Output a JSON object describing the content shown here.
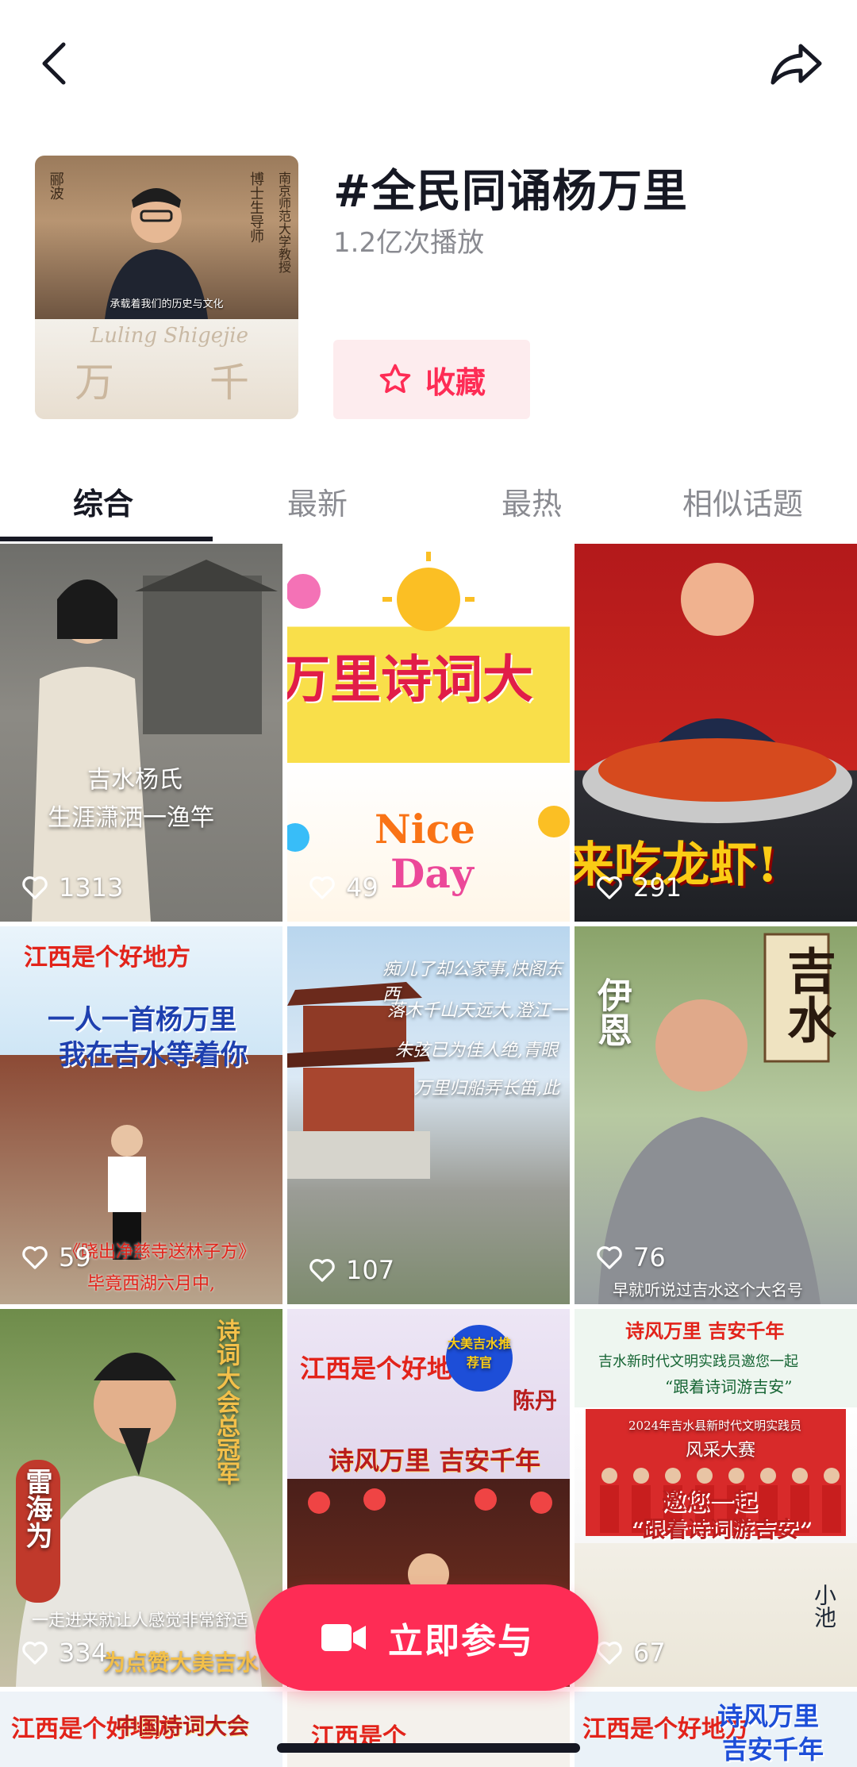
{
  "header": {
    "back_icon": "chevron-left-icon",
    "share_icon": "share-arrow-icon"
  },
  "topic": {
    "title": "#全民同诵杨万里",
    "play_count": "1.2亿次播放",
    "favorite_label": "收藏",
    "favorite_icon": "star-icon",
    "cover": {
      "name_vertical": "郦波",
      "desc_vertical_1": "博士生导师",
      "desc_vertical_2": "南京师范大学教授",
      "caption": "承载着我们的历史与文化",
      "art_title": "Luling Shigejie",
      "art_char_1": "万",
      "art_char_2": "千"
    }
  },
  "tabs": [
    {
      "label": "综合",
      "active": true
    },
    {
      "label": "最新",
      "active": false
    },
    {
      "label": "最热",
      "active": false
    },
    {
      "label": "相似话题",
      "active": false
    }
  ],
  "videos": [
    {
      "likes": "1313",
      "caption_1": "吉水杨氏",
      "caption_2": "生涯潇洒一渔竿"
    },
    {
      "likes": "49",
      "caption_1": "万里诗词大",
      "caption_2": "Nice",
      "caption_3": "Day"
    },
    {
      "likes": "291",
      "caption_1": "来吃龙虾!"
    },
    {
      "likes": "59",
      "caption_1": "江西是个好地方",
      "caption_2": "一人一首杨万里",
      "caption_3": "我在吉水等着你",
      "caption_4": "《晓出净慈寺送林子方》",
      "caption_5": "毕竟西湖六月中,"
    },
    {
      "likes": "107",
      "caption_1": "痴儿了却公家事,快阁东西",
      "caption_2": "落木千山天远大,澄江一",
      "caption_3": "朱弦已为佳人绝,青眼",
      "caption_4": "万里归船弄长笛,此"
    },
    {
      "likes": "76",
      "caption_1": "伊恩",
      "caption_2": "吉水",
      "caption_3": "早就听说过吉水这个大名号"
    },
    {
      "likes": "334",
      "caption_1": "雷海为",
      "caption_2": "诗词大会总冠军",
      "caption_3": "一走进来就让人感觉非常舒适",
      "caption_4": "为点赞大美吉水"
    },
    {
      "likes": "",
      "caption_1": "江西是个好地方",
      "caption_2": "大美吉水推荐官",
      "caption_3": "陈丹",
      "caption_4": "诗风万里 吉安千年"
    },
    {
      "likes": "67",
      "caption_1": "诗风万里 吉安千年",
      "caption_2": "吉水新时代文明实践员邀您一起",
      "caption_3": "“跟着诗词游吉安”",
      "caption_4": "邀您一起",
      "caption_5": "“跟着诗词游吉安”",
      "caption_6": "2024年吉水县新时代文明实践员",
      "caption_7": "风采大赛",
      "caption_8": "小池"
    },
    {
      "likes": "",
      "caption_1": "江西是个好地方",
      "caption_2": "中国诗词大会"
    },
    {
      "likes": "",
      "caption_1": "江西是个"
    },
    {
      "likes": "",
      "caption_1": "江西是个好地方",
      "caption_2": "诗风万里",
      "caption_3": "吉安千年"
    }
  ],
  "cta": {
    "label": "立即参与",
    "icon": "video-camera-icon"
  },
  "colors": {
    "accent": "#fe2c55",
    "accent_light": "#fdecee",
    "text_primary": "#161823",
    "text_secondary": "#8a8b91"
  }
}
